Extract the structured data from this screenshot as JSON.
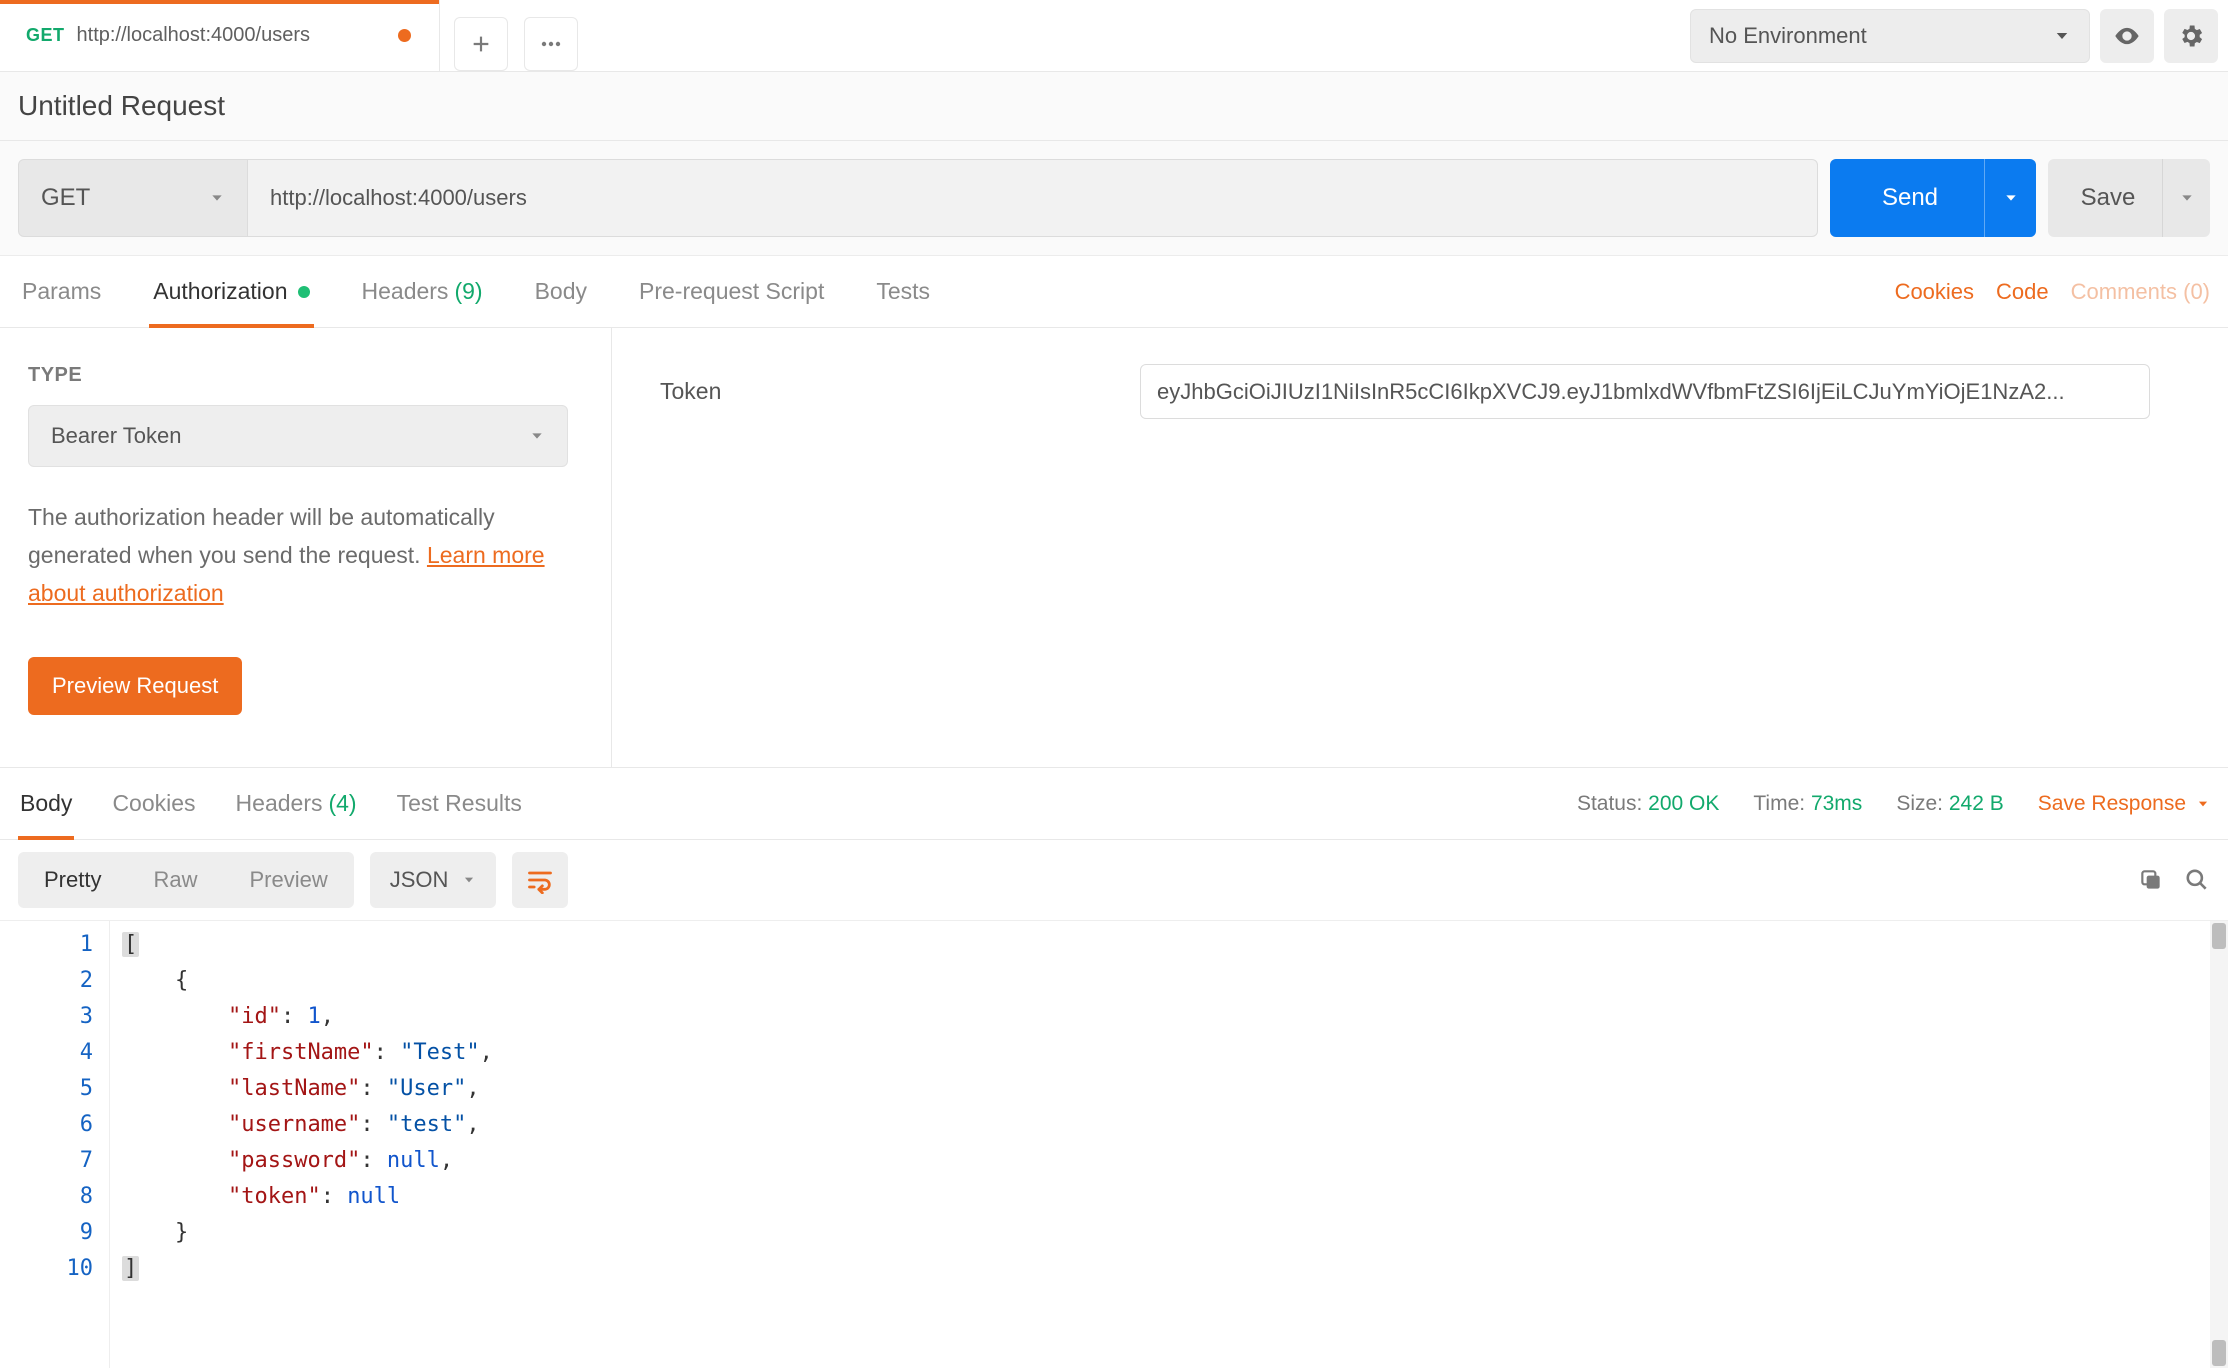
{
  "colors": {
    "accent": "#ed6b1f",
    "primary": "#0b7bf0",
    "success": "#12a96c"
  },
  "tabs": [
    {
      "method": "GET",
      "title": "http://localhost:4000/users",
      "dirty": true
    }
  ],
  "environment": {
    "selected": "No Environment"
  },
  "request": {
    "name": "Untitled Request",
    "method": "GET",
    "url": "http://localhost:4000/users",
    "send_label": "Send",
    "save_label": "Save"
  },
  "request_tabs": {
    "params": "Params",
    "authorization": "Authorization",
    "headers_label": "Headers",
    "headers_count": "(9)",
    "body": "Body",
    "prerequest": "Pre-request Script",
    "tests": "Tests",
    "active": "authorization"
  },
  "request_links": {
    "cookies": "Cookies",
    "code": "Code",
    "comments": "Comments (0)"
  },
  "auth": {
    "type_label": "TYPE",
    "type_value": "Bearer Token",
    "note_text": "The authorization header will be automatically generated when you send the request. ",
    "learn_more": "Learn more about authorization",
    "preview_label": "Preview Request",
    "token_key": "Token",
    "token_value": "eyJhbGciOiJIUzI1NiIsInR5cCI6IkpXVCJ9.eyJ1bmlxdWVfbmFtZSI6IjEiLCJuYmYiOjE1NzA2..."
  },
  "response_tabs": {
    "body": "Body",
    "cookies": "Cookies",
    "headers_label": "Headers",
    "headers_count": "(4)",
    "test_results": "Test Results",
    "active": "body"
  },
  "response_meta": {
    "status_label": "Status:",
    "status_value": "200 OK",
    "time_label": "Time:",
    "time_value": "73ms",
    "size_label": "Size:",
    "size_value": "242 B",
    "save_response": "Save Response"
  },
  "response_toolbar": {
    "pretty": "Pretty",
    "raw": "Raw",
    "preview": "Preview",
    "format": "JSON"
  },
  "code": {
    "line_numbers": [
      "1",
      "2",
      "3",
      "4",
      "5",
      "6",
      "7",
      "8",
      "9",
      "10"
    ],
    "lines": [
      [
        {
          "t": "[",
          "cls": "bracket-hl"
        }
      ],
      [
        {
          "t": "    {",
          "cls": "tok-punc"
        }
      ],
      [
        {
          "t": "        ",
          "cls": ""
        },
        {
          "t": "\"id\"",
          "cls": "tok-key"
        },
        {
          "t": ": ",
          "cls": "tok-punc"
        },
        {
          "t": "1",
          "cls": "tok-num"
        },
        {
          "t": ",",
          "cls": "tok-punc"
        }
      ],
      [
        {
          "t": "        ",
          "cls": ""
        },
        {
          "t": "\"firstName\"",
          "cls": "tok-key"
        },
        {
          "t": ": ",
          "cls": "tok-punc"
        },
        {
          "t": "\"Test\"",
          "cls": "tok-str"
        },
        {
          "t": ",",
          "cls": "tok-punc"
        }
      ],
      [
        {
          "t": "        ",
          "cls": ""
        },
        {
          "t": "\"lastName\"",
          "cls": "tok-key"
        },
        {
          "t": ": ",
          "cls": "tok-punc"
        },
        {
          "t": "\"User\"",
          "cls": "tok-str"
        },
        {
          "t": ",",
          "cls": "tok-punc"
        }
      ],
      [
        {
          "t": "        ",
          "cls": ""
        },
        {
          "t": "\"username\"",
          "cls": "tok-key"
        },
        {
          "t": ": ",
          "cls": "tok-punc"
        },
        {
          "t": "\"test\"",
          "cls": "tok-str"
        },
        {
          "t": ",",
          "cls": "tok-punc"
        }
      ],
      [
        {
          "t": "        ",
          "cls": ""
        },
        {
          "t": "\"password\"",
          "cls": "tok-key"
        },
        {
          "t": ": ",
          "cls": "tok-punc"
        },
        {
          "t": "null",
          "cls": "tok-null"
        },
        {
          "t": ",",
          "cls": "tok-punc"
        }
      ],
      [
        {
          "t": "        ",
          "cls": ""
        },
        {
          "t": "\"token\"",
          "cls": "tok-key"
        },
        {
          "t": ": ",
          "cls": "tok-punc"
        },
        {
          "t": "null",
          "cls": "tok-null"
        }
      ],
      [
        {
          "t": "    }",
          "cls": "tok-punc"
        }
      ],
      [
        {
          "t": "]",
          "cls": "bracket-hl"
        }
      ]
    ]
  }
}
